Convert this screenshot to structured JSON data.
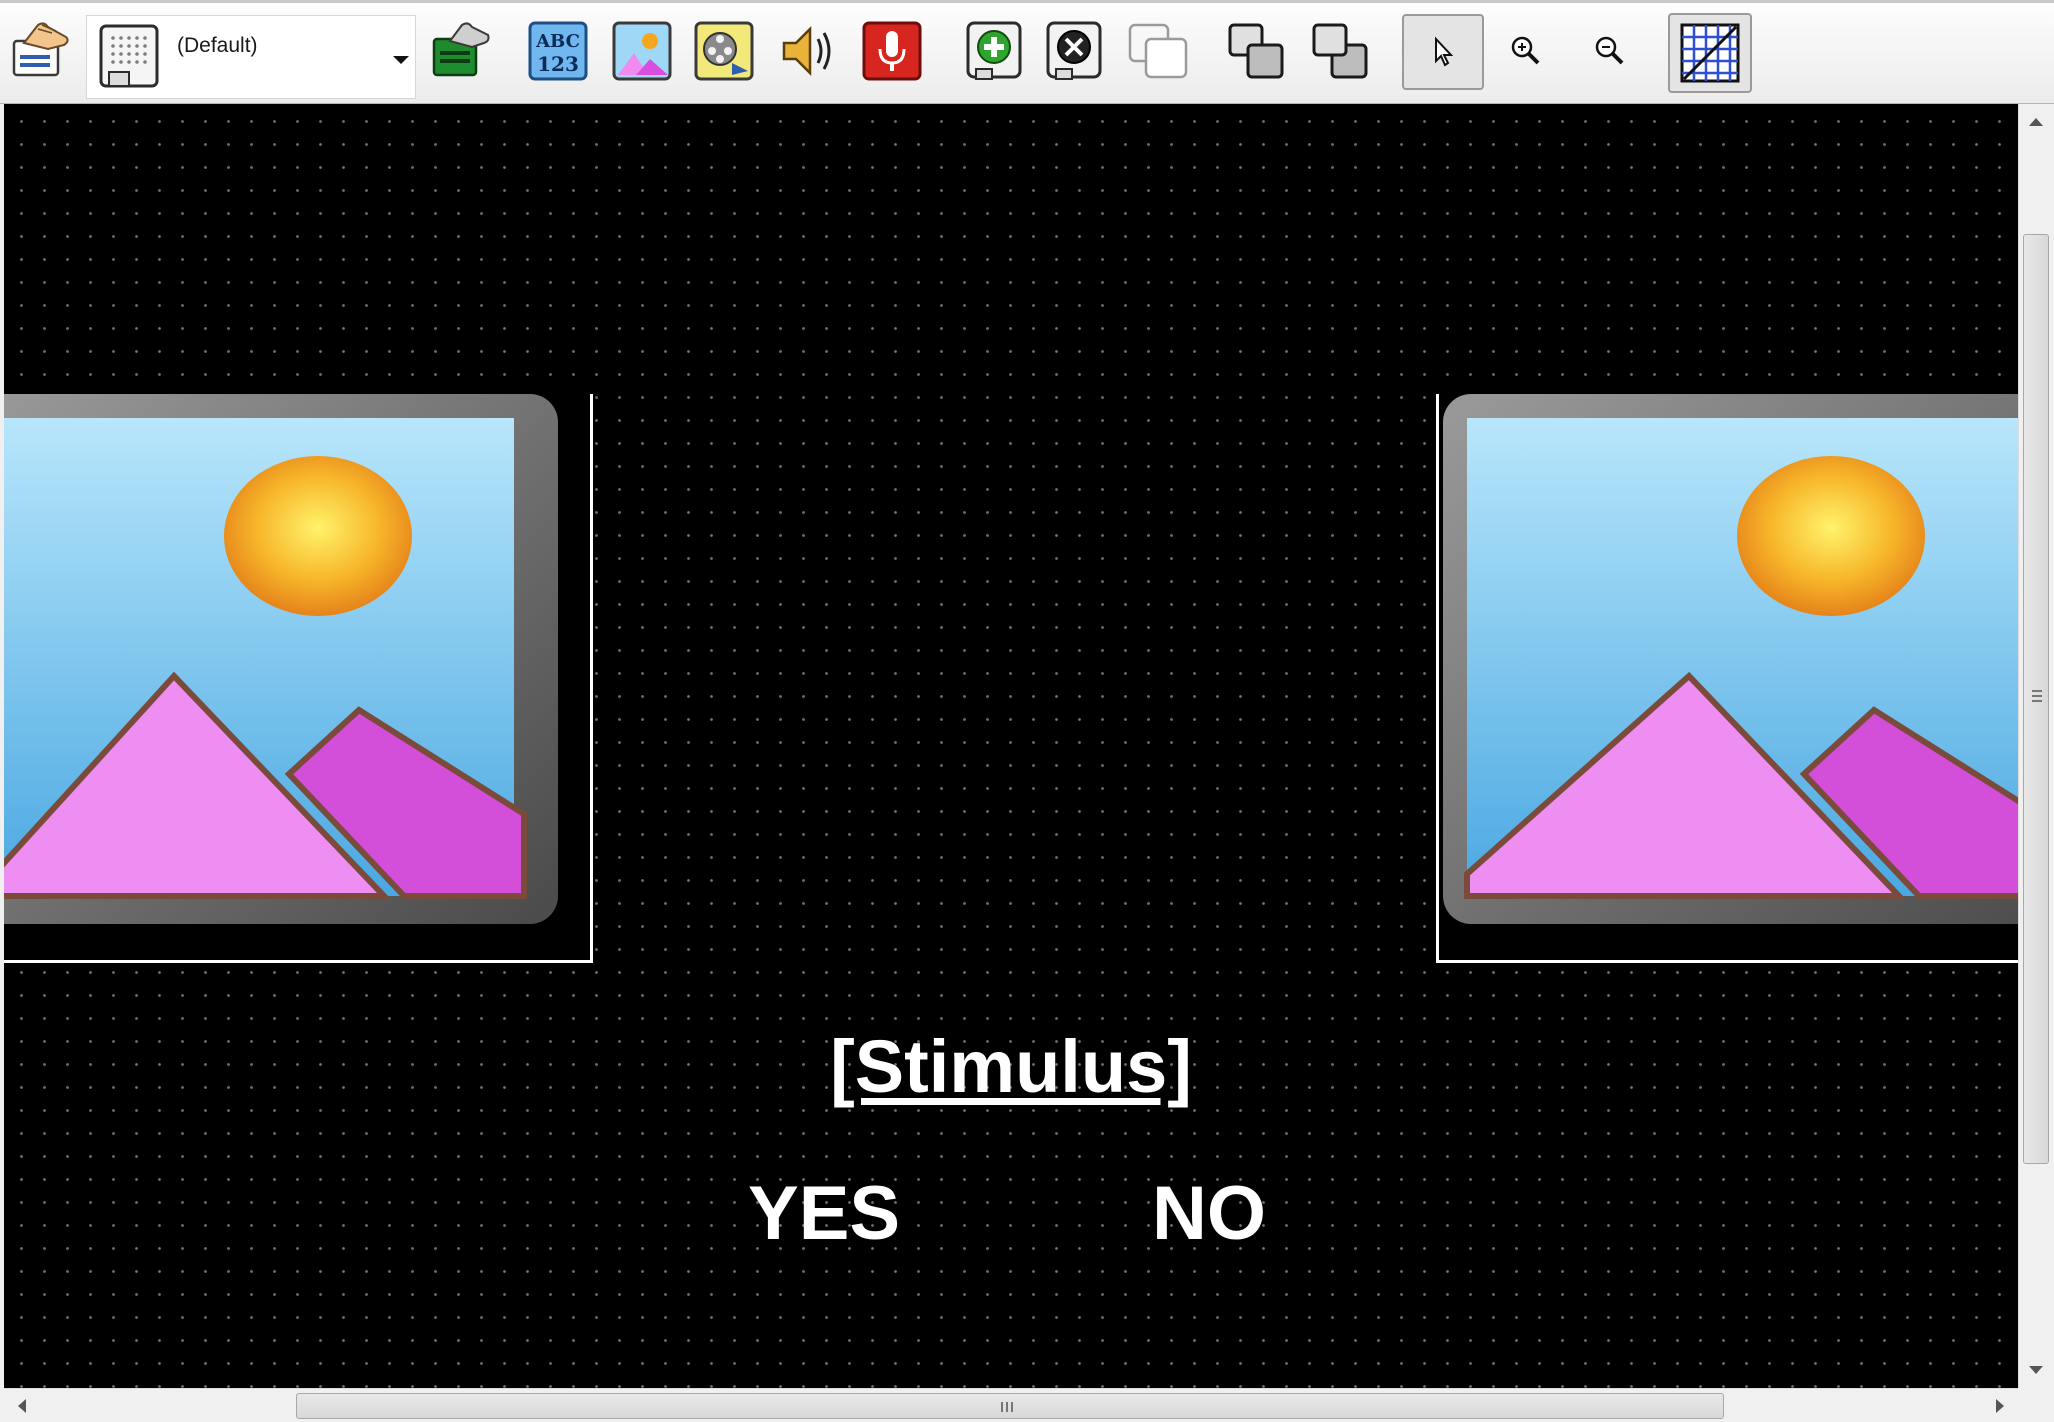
{
  "toolbar": {
    "layout_selector": {
      "value": "(Default)",
      "icon": "slide-layout-icon"
    },
    "buttons": [
      "slide-properties-icon",
      "layout-properties-icon",
      "text-object-icon",
      "image-object-icon",
      "movie-object-icon",
      "sound-out-icon",
      "sound-in-icon",
      "add-slide-icon",
      "remove-slide-icon",
      "copy-slide-icon",
      "send-backward-icon",
      "bring-forward-icon",
      "select-pointer-icon",
      "zoom-in-icon",
      "zoom-out-icon",
      "snap-to-grid-icon"
    ]
  },
  "canvas": {
    "background": "#000000",
    "grid_dots": "#6e6e6e",
    "stimulus_text": "[Stimulus]",
    "yes_text": "YES",
    "no_text": "NO",
    "image_left": "image-placeholder-icon",
    "image_right": "image-placeholder-icon"
  },
  "colors": {
    "sky": "#8fd3f7",
    "sun": "#f5a623",
    "mountain": "#e07ee6",
    "frame": "#6a6a6a"
  }
}
